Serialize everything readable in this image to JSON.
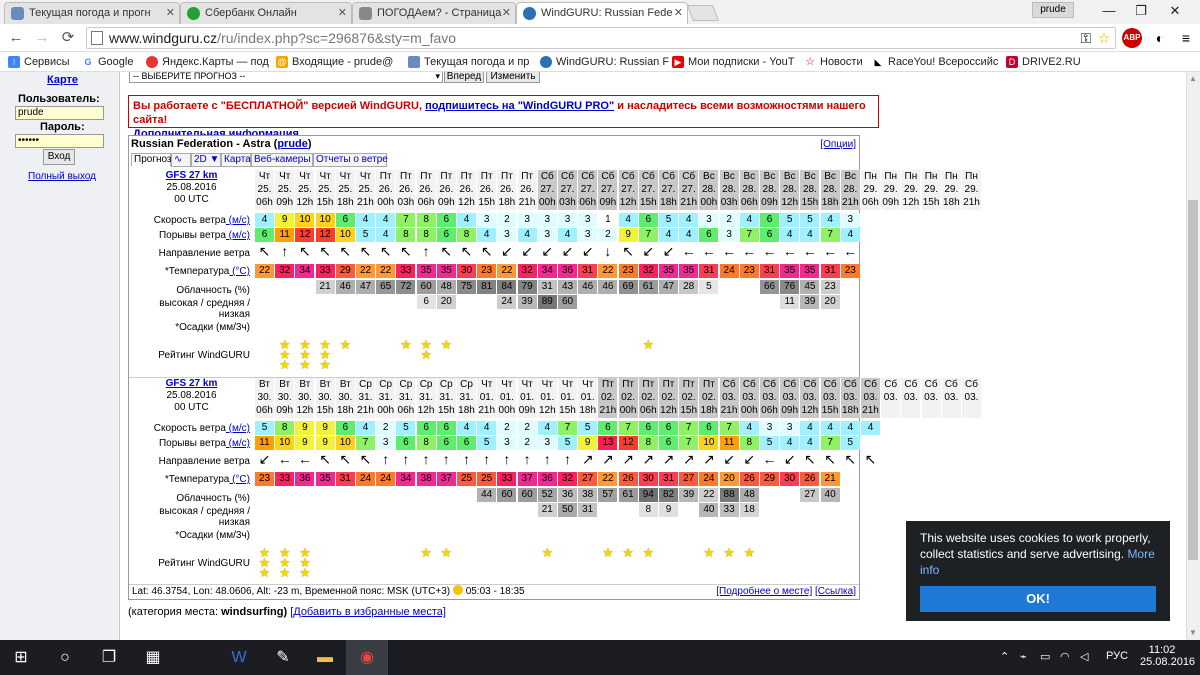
{
  "browser": {
    "tabs": [
      {
        "label": "Текущая погода и прогн",
        "active": false
      },
      {
        "label": "Сбербанк Онлайн",
        "active": false
      },
      {
        "label": "ПОГОДАем? - Страница",
        "active": false
      },
      {
        "label": "WindGURU: Russian Fede",
        "active": true
      }
    ],
    "user": "prude",
    "url_host": "www.windguru.cz",
    "url_path": "/ru/index.php?sc=296876&sty=m_favo",
    "bookmarks": [
      "Сервисы",
      "Google",
      "Яндекс.Карты — под",
      "Входящие - prude@",
      "Текущая погода и пр",
      "WindGURU: Russian F",
      "Мои подписки - YouT",
      "Новости",
      "RaceYou! Всероссийс",
      "DRIVE2.RU"
    ]
  },
  "sidebar": {
    "map_link": "Карте",
    "user_label": "Пользователь:",
    "user_value": "prude",
    "pass_label": "Пароль:",
    "pass_value": "••••••",
    "login_btn": "Вход",
    "logout_link": "Полный выход"
  },
  "topform": {
    "select_value": "-- ВЫБЕРИТЕ ПРОГНОЗ --",
    "next_btn": "Вперед",
    "change_btn": "Изменить"
  },
  "promo": {
    "text1": "Вы работаете с \"БЕСПЛАТНОЙ\" версией WindGURU,",
    "link1": "подпишитесь на \"WindGURU PRO\"",
    "text2": "и насладитесь всеми возможностями нашего сайта!",
    "link2": "Дополнительная информация..."
  },
  "widget": {
    "title": "Russian Federation - Astra",
    "user": "prude",
    "options": "[Опции]",
    "tabs": [
      "Прогноз",
      "2D ▼",
      "Карта",
      "Веб-камеры",
      "Отчеты о ветре"
    ],
    "labels": {
      "speed": "Скорость ветра",
      "gust": "Порывы ветра",
      "unit": "(м/с)",
      "dir": "Направление ветра",
      "temp": "*Температура",
      "temp_unit": "(°C)",
      "cloud1": "Облачность (%)",
      "cloud2": "высокая / средняя / низкая",
      "precip": "*Осадки (мм/3ч)",
      "rating": "Рейтинг WindGURU"
    },
    "blocks": [
      {
        "model": "GFS 27 km",
        "date": "25.08.2016",
        "utc": "00 UTC",
        "days": [
          "Чт",
          "Чт",
          "Чт",
          "Чт",
          "Чт",
          "Чт",
          "Пт",
          "Пт",
          "Пт",
          "Пт",
          "Пт",
          "Пт",
          "Пт",
          "Пт",
          "Сб",
          "Сб",
          "Сб",
          "Сб",
          "Сб",
          "Сб",
          "Сб",
          "Сб",
          "Вс",
          "Вс",
          "Вс",
          "Вс",
          "Вс",
          "Вс",
          "Вс",
          "Вс",
          "Пн",
          "Пн",
          "Пн",
          "Пн",
          "Пн",
          "Пн"
        ],
        "dates": [
          "25.",
          "25.",
          "25.",
          "25.",
          "25.",
          "25.",
          "26.",
          "26.",
          "26.",
          "26.",
          "26.",
          "26.",
          "26.",
          "26.",
          "27.",
          "27.",
          "27.",
          "27.",
          "27.",
          "27.",
          "27.",
          "27.",
          "28.",
          "28.",
          "28.",
          "28.",
          "28.",
          "28.",
          "28.",
          "28.",
          "29.",
          "29.",
          "29.",
          "29.",
          "29.",
          "29."
        ],
        "hours": [
          "06h",
          "09h",
          "12h",
          "15h",
          "18h",
          "21h",
          "00h",
          "03h",
          "06h",
          "09h",
          "12h",
          "15h",
          "18h",
          "21h",
          "00h",
          "03h",
          "06h",
          "09h",
          "12h",
          "15h",
          "18h",
          "21h",
          "00h",
          "03h",
          "06h",
          "09h",
          "12h",
          "15h",
          "18h",
          "21h",
          "06h",
          "09h",
          "12h",
          "15h",
          "18h",
          "21h"
        ],
        "weekend": [
          false,
          false,
          false,
          false,
          false,
          false,
          false,
          false,
          false,
          false,
          false,
          false,
          false,
          false,
          true,
          true,
          true,
          true,
          true,
          true,
          true,
          true,
          true,
          true,
          true,
          true,
          true,
          true,
          true,
          true,
          false,
          false,
          false,
          false,
          false,
          false
        ],
        "speed": [
          "4",
          "9",
          "10",
          "10",
          "6",
          "4",
          "4",
          "7",
          "8",
          "6",
          "4",
          "3",
          "2",
          "3",
          "3",
          "3",
          "3",
          "1",
          "4",
          "6",
          "5",
          "4",
          "3",
          "2",
          "4",
          "6",
          "5",
          "5",
          "4",
          "3",
          "",
          "",
          "",
          "",
          "",
          ""
        ],
        "gust": [
          "6",
          "11",
          "12",
          "12",
          "10",
          "5",
          "4",
          "8",
          "8",
          "6",
          "8",
          "4",
          "3",
          "4",
          "3",
          "4",
          "3",
          "2",
          "9",
          "7",
          "4",
          "4",
          "6",
          "3",
          "7",
          "6",
          "4",
          "4",
          "7",
          "4",
          "",
          "",
          "",
          "",
          "",
          ""
        ],
        "dir": [
          "↖",
          "↑",
          "↖",
          "↖",
          "↖",
          "↖",
          "↖",
          "↖",
          "↑",
          "↖",
          "↖",
          "↖",
          "↙",
          "↙",
          "↙",
          "↙",
          "↙",
          "↓",
          "↖",
          "↙",
          "↙",
          "←",
          "←",
          "←",
          "←",
          "←",
          "←",
          "←",
          "←",
          "←",
          "",
          "",
          "",
          "",
          "",
          ""
        ],
        "temp": [
          "22",
          "32",
          "34",
          "33",
          "29",
          "22",
          "22",
          "33",
          "35",
          "35",
          "30",
          "23",
          "22",
          "32",
          "34",
          "36",
          "31",
          "22",
          "23",
          "32",
          "35",
          "35",
          "31",
          "24",
          "23",
          "31",
          "35",
          "35",
          "31",
          "23",
          "",
          "",
          "",
          "",
          "",
          ""
        ],
        "cloud_h": [
          "",
          "",
          "",
          "21",
          "46",
          "47",
          "65",
          "72",
          "60",
          "48",
          "75",
          "81",
          "84",
          "79",
          "31",
          "43",
          "46",
          "46",
          "69",
          "61",
          "47",
          "28",
          "5",
          "",
          "",
          "66",
          "76",
          "45",
          "23",
          "",
          "",
          "",
          "",
          "",
          "",
          ""
        ],
        "cloud_m": [
          "",
          "",
          "",
          "",
          "",
          "",
          "",
          "",
          "6",
          "20",
          "",
          "",
          "24",
          "39",
          "89",
          "60",
          "",
          "",
          "",
          "",
          "",
          "",
          "",
          "",
          "",
          "",
          "11",
          "39",
          "20",
          "",
          "",
          "",
          "",
          "",
          "",
          ""
        ],
        "rating": [
          0,
          3,
          3,
          3,
          1,
          0,
          0,
          1,
          2,
          1,
          0,
          0,
          0,
          0,
          0,
          0,
          0,
          0,
          0,
          1,
          0,
          0,
          0,
          0,
          0,
          0,
          0,
          0,
          0,
          0,
          0,
          0,
          0,
          0,
          0,
          0
        ]
      },
      {
        "model": "GFS 27 km",
        "date": "25.08.2016",
        "utc": "00 UTC",
        "days": [
          "Вт",
          "Вт",
          "Вт",
          "Вт",
          "Вт",
          "Ср",
          "Ср",
          "Ср",
          "Ср",
          "Ср",
          "Ср",
          "Чт",
          "Чт",
          "Чт",
          "Чт",
          "Чт",
          "Чт",
          "Пт",
          "Пт",
          "Пт",
          "Пт",
          "Пт",
          "Пт",
          "Сб",
          "Сб",
          "Сб",
          "Сб",
          "Сб",
          "Сб",
          "Сб",
          "Сб",
          "Сб",
          "Сб",
          "Сб",
          "Сб",
          "Сб"
        ],
        "dates": [
          "30.",
          "30.",
          "30.",
          "30.",
          "30.",
          "31.",
          "31.",
          "31.",
          "31.",
          "31.",
          "31.",
          "01.",
          "01.",
          "01.",
          "01.",
          "01.",
          "01.",
          "02.",
          "02.",
          "02.",
          "02.",
          "02.",
          "02.",
          "03.",
          "03.",
          "03.",
          "03.",
          "03.",
          "03.",
          "03.",
          "03.",
          "03.",
          "03.",
          "03.",
          "03.",
          "03."
        ],
        "hours": [
          "06h",
          "09h",
          "12h",
          "15h",
          "18h",
          "21h",
          "00h",
          "06h",
          "12h",
          "15h",
          "18h",
          "21h",
          "00h",
          "09h",
          "12h",
          "15h",
          "18h",
          "21h",
          "00h",
          "06h",
          "12h",
          "15h",
          "18h",
          "21h",
          "00h",
          "06h",
          "09h",
          "12h",
          "15h",
          "18h",
          "21h",
          "",
          "",
          "",
          "",
          ""
        ],
        "weekend": [
          false,
          false,
          false,
          false,
          false,
          false,
          false,
          false,
          false,
          false,
          false,
          false,
          false,
          false,
          false,
          false,
          false,
          true,
          true,
          true,
          true,
          true,
          true,
          true,
          true,
          true,
          true,
          true,
          true,
          true,
          true,
          false,
          false,
          false,
          false,
          false
        ],
        "speed": [
          "5",
          "8",
          "9",
          "9",
          "6",
          "4",
          "2",
          "5",
          "6",
          "6",
          "4",
          "4",
          "2",
          "2",
          "4",
          "7",
          "5",
          "6",
          "7",
          "6",
          "6",
          "7",
          "6",
          "7",
          "4",
          "3",
          "3",
          "4",
          "4",
          "4",
          "4",
          "",
          "",
          "",
          "",
          ""
        ],
        "gust": [
          "11",
          "10",
          "9",
          "9",
          "10",
          "7",
          "3",
          "6",
          "8",
          "6",
          "6",
          "5",
          "3",
          "2",
          "3",
          "5",
          "9",
          "13",
          "12",
          "8",
          "6",
          "7",
          "10",
          "11",
          "8",
          "5",
          "4",
          "4",
          "7",
          "5",
          "",
          "",
          "",
          "",
          "",
          ""
        ],
        "dir": [
          "↙",
          "←",
          "←",
          "↖",
          "↖",
          "↖",
          "↑",
          "↑",
          "↑",
          "↑",
          "↑",
          "↑",
          "↑",
          "↑",
          "↑",
          "↑",
          "↗",
          "↗",
          "↗",
          "↗",
          "↗",
          "↗",
          "↗",
          "↙",
          "↙",
          "←",
          "↙",
          "↖",
          "↖",
          "↖",
          "↖",
          "",
          "",
          "",
          "",
          ""
        ],
        "temp": [
          "23",
          "33",
          "36",
          "35",
          "31",
          "24",
          "24",
          "34",
          "38",
          "37",
          "25",
          "25",
          "33",
          "37",
          "36",
          "32",
          "27",
          "22",
          "26",
          "30",
          "31",
          "27",
          "24",
          "20",
          "26",
          "29",
          "30",
          "26",
          "21",
          "",
          "",
          "",
          "",
          "",
          "",
          ""
        ],
        "cloud_h": [
          "",
          "",
          "",
          "",
          "",
          "",
          "",
          "",
          "",
          "",
          "",
          "44",
          "60",
          "60",
          "52",
          "36",
          "38",
          "57",
          "61",
          "94",
          "82",
          "39",
          "22",
          "88",
          "48",
          "",
          "",
          "27",
          "40",
          "",
          "",
          "",
          "",
          "",
          "",
          ""
        ],
        "cloud_m": [
          "",
          "",
          "",
          "",
          "",
          "",
          "",
          "",
          "",
          "",
          "",
          "",
          "",
          "",
          "21",
          "50",
          "31",
          "",
          "",
          "8",
          "9",
          "",
          "40",
          "33",
          "18",
          "",
          "",
          "",
          "",
          "",
          "",
          "",
          "",
          "",
          "",
          ""
        ],
        "rating": [
          3,
          3,
          3,
          0,
          0,
          0,
          0,
          0,
          1,
          1,
          0,
          0,
          0,
          0,
          1,
          0,
          0,
          1,
          1,
          1,
          0,
          0,
          1,
          1,
          1,
          0,
          0,
          0,
          0,
          0,
          0,
          0,
          0,
          0,
          0,
          0
        ]
      }
    ],
    "footer": {
      "coords": "Lat: 46.3754, Lon: 48.0606, Alt: -23 m, Временной пояс: MSK (UTC+3)",
      "sun": "05:03 - 18:35",
      "more": "[Подробнее о месте]",
      "link": "[Ссылка]"
    }
  },
  "below": {
    "category_label": "(категория места:",
    "category_value": "windsurfing)",
    "add_fav": "[Добавить в избранные места]"
  },
  "cookie": {
    "text": "This website uses cookies to work properly, collect statistics and serve advertising.",
    "more": "More info",
    "ok": "OK!"
  },
  "taskbar": {
    "lang": "РУС",
    "time": "11:02",
    "date": "25.08.2016"
  },
  "colors": {
    "promo_red": "#cc0000",
    "link_blue": "#0000cc",
    "cookie_bg": "#1d2124",
    "cookie_btn": "#1d78d6"
  }
}
